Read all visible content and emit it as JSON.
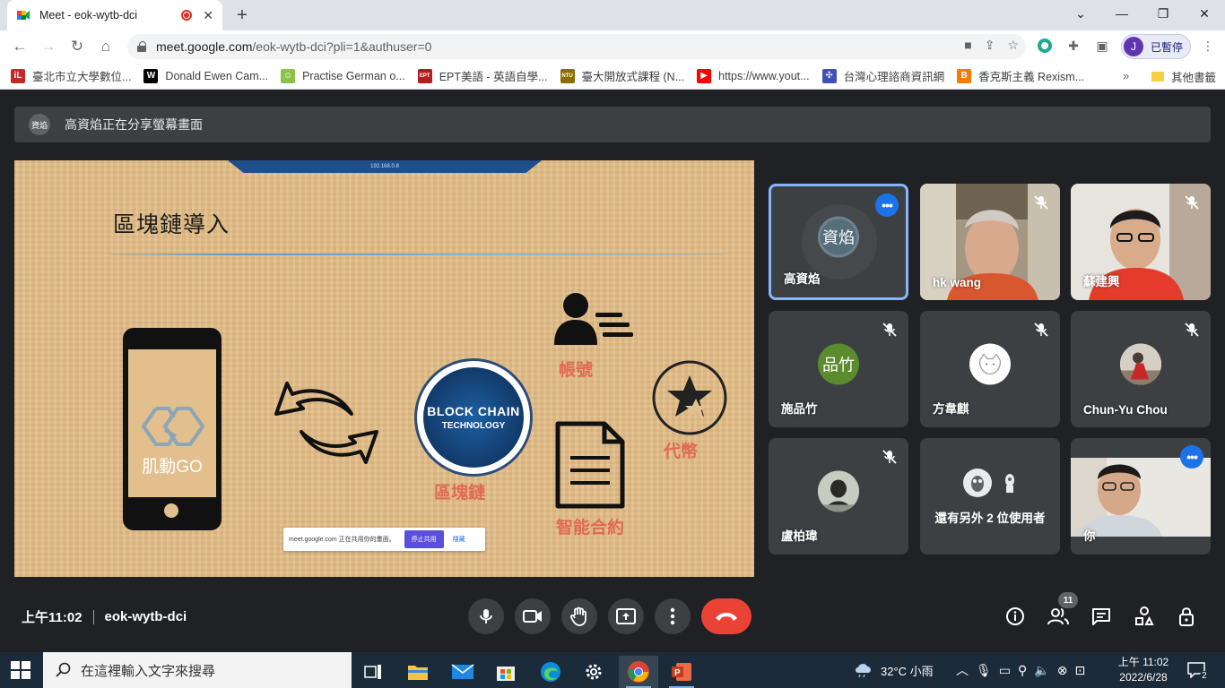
{
  "browser": {
    "tab_title": "Meet - eok-wytb-dci",
    "new_tab": "+",
    "url_domain": "meet.google.com",
    "url_path": "/eok-wytb-dci?pli=1&authuser=0",
    "profile_initial": "J",
    "profile_label": "已暫停",
    "bookmarks": [
      {
        "label": "臺北市立大學數位...",
        "icon": "iL",
        "color": "#c62828"
      },
      {
        "label": "Donald Ewen Cam...",
        "icon": "W",
        "color": "#000000"
      },
      {
        "label": "Practise German o...",
        "icon": "☺",
        "color": "#8bc34a"
      },
      {
        "label": "EPT美語 - 英語自學...",
        "icon": "EPT",
        "color": "#b71c1c"
      },
      {
        "label": "臺大開放式課程 (N...",
        "icon": "NTU",
        "color": "#8d6e00"
      },
      {
        "label": "https://www.yout...",
        "icon": "▶",
        "color": "#ff0000"
      },
      {
        "label": "台灣心理諮商資訊網",
        "icon": "✣",
        "color": "#3f51b5"
      },
      {
        "label": "香克斯主義 Rexism...",
        "icon": "B",
        "color": "#f57c00"
      }
    ],
    "bookmarks_more": "»",
    "other_bookmarks": "其他書籤"
  },
  "meet": {
    "banner_avatar": "資焰",
    "banner_text": "高資焰正在分享螢幕畫面",
    "slide": {
      "rdp_ip": "192.168.0.8",
      "title": "區塊鏈導入",
      "phone_brand": "肌動GO",
      "chain_line1": "BLOCK CHAIN",
      "chain_line2": "TECHNOLOGY",
      "label_chain": "區塊鏈",
      "label_account": "帳號",
      "label_token": "代幣",
      "label_contract": "智能合約",
      "share_text": "meet.google.com 正在共用你的畫面。",
      "share_stop": "停止共用",
      "share_hide": "隱藏"
    },
    "participants": [
      {
        "name": "高資焰",
        "avatar_text": "資焰",
        "avatar_color": "#546e7a",
        "muted": false,
        "speaking": true
      },
      {
        "name": "hk wang",
        "video": true,
        "muted": true
      },
      {
        "name": "蘇建興",
        "video": true,
        "muted": true
      },
      {
        "name": "施品竹",
        "avatar_text": "品竹",
        "avatar_color": "#5c8b2e",
        "muted": true
      },
      {
        "name": "方韋麒",
        "avatar_text": "",
        "avatar_color": "#ffffff",
        "muted": true
      },
      {
        "name": "Chun-Yu Chou",
        "avatar_text": "",
        "avatar_color": "#c7b7a6",
        "muted": true
      },
      {
        "name": "盧柏瑋",
        "avatar_text": "",
        "avatar_color": "#9aa592",
        "muted": true
      },
      {
        "name": "還有另外 2 位使用者",
        "overflow": true
      },
      {
        "name": "你",
        "video": true,
        "muted": false,
        "speaking": true
      }
    ],
    "time": "上午11:02",
    "meeting_code": "eok-wytb-dci",
    "people_count": "11"
  },
  "taskbar": {
    "search_placeholder": "在這裡輸入文字來搜尋",
    "weather": "32°C 小雨",
    "time": "上午 11:02",
    "date": "2022/6/28",
    "notifications": "2"
  }
}
